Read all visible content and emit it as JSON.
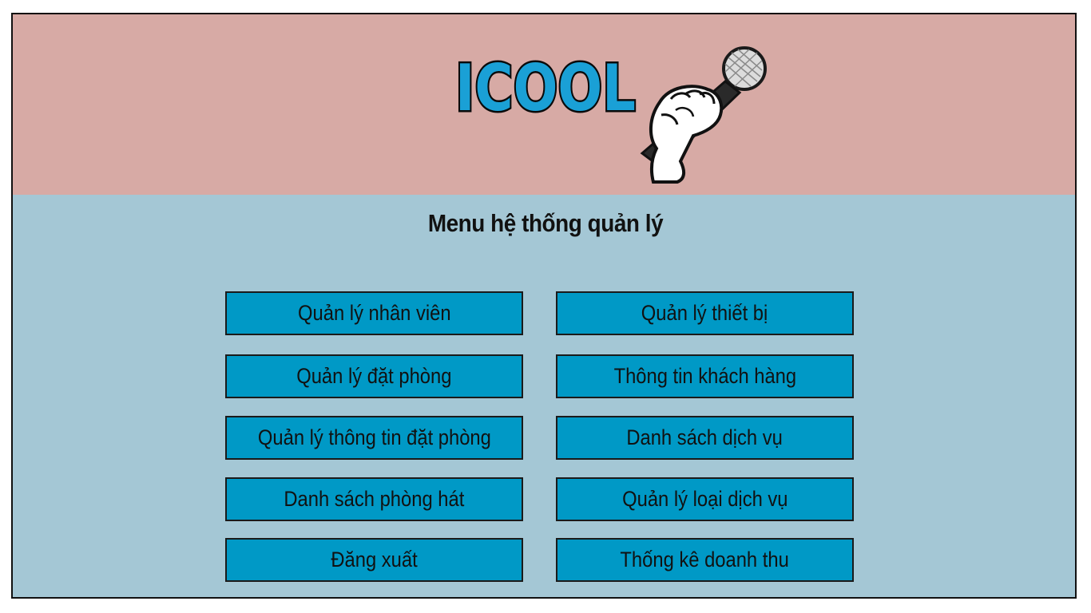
{
  "app": {
    "logo_text": "ICOOL",
    "title": "Menu hệ thống quản lý"
  },
  "colors": {
    "header_bg": "#d7aaa5",
    "body_bg": "#a4c7d5",
    "button_bg": "#0099c6",
    "logo_blue": "#1aa0d6"
  },
  "menu": {
    "left": [
      {
        "label": "Quản lý nhân viên"
      },
      {
        "label": "Quản lý đặt phòng"
      },
      {
        "label": "Quản lý thông tin đặt phòng"
      },
      {
        "label": "Danh sách phòng hát"
      },
      {
        "label": "Đăng xuất"
      }
    ],
    "right": [
      {
        "label": "Quản lý thiết bị"
      },
      {
        "label": "Thông tin khách hàng"
      },
      {
        "label": "Danh sách dịch vụ"
      },
      {
        "label": "Quản lý loại dịch vụ"
      },
      {
        "label": "Thống kê doanh thu"
      }
    ]
  },
  "icons": {
    "logo": "microphone-in-hand-icon"
  }
}
